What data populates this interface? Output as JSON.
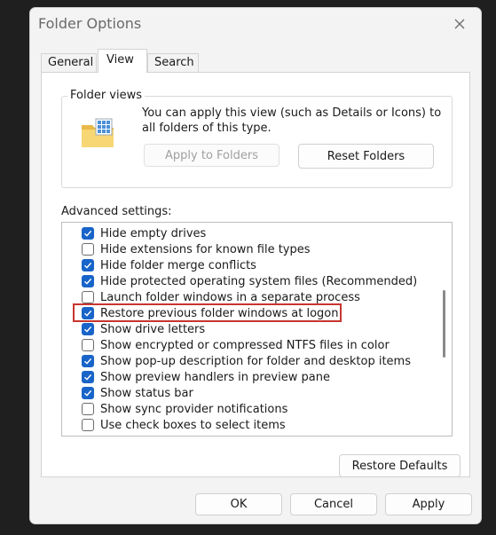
{
  "window": {
    "title": "Folder Options"
  },
  "tabs": [
    {
      "label": "General"
    },
    {
      "label": "View"
    },
    {
      "label": "Search"
    }
  ],
  "folder_views": {
    "title": "Folder views",
    "description": "You can apply this view (such as Details or Icons) to all folders of this type.",
    "apply_button": "Apply to Folders",
    "reset_button": "Reset Folders"
  },
  "advanced": {
    "label": "Advanced settings:",
    "items": [
      {
        "label": "Hide empty drives",
        "checked": true
      },
      {
        "label": "Hide extensions for known file types",
        "checked": false
      },
      {
        "label": "Hide folder merge conflicts",
        "checked": true
      },
      {
        "label": "Hide protected operating system files (Recommended)",
        "checked": true
      },
      {
        "label": "Launch folder windows in a separate process",
        "checked": false
      },
      {
        "label": "Restore previous folder windows at logon",
        "checked": true
      },
      {
        "label": "Show drive letters",
        "checked": true
      },
      {
        "label": "Show encrypted or compressed NTFS files in color",
        "checked": false
      },
      {
        "label": "Show pop-up description for folder and desktop items",
        "checked": true
      },
      {
        "label": "Show preview handlers in preview pane",
        "checked": true
      },
      {
        "label": "Show status bar",
        "checked": true
      },
      {
        "label": "Show sync provider notifications",
        "checked": false
      },
      {
        "label": "Use check boxes to select items",
        "checked": false
      }
    ],
    "restore_defaults": "Restore Defaults"
  },
  "footer": {
    "ok": "OK",
    "cancel": "Cancel",
    "apply": "Apply"
  },
  "colors": {
    "accent": "#1864c9",
    "highlight_border": "#c8352e"
  }
}
